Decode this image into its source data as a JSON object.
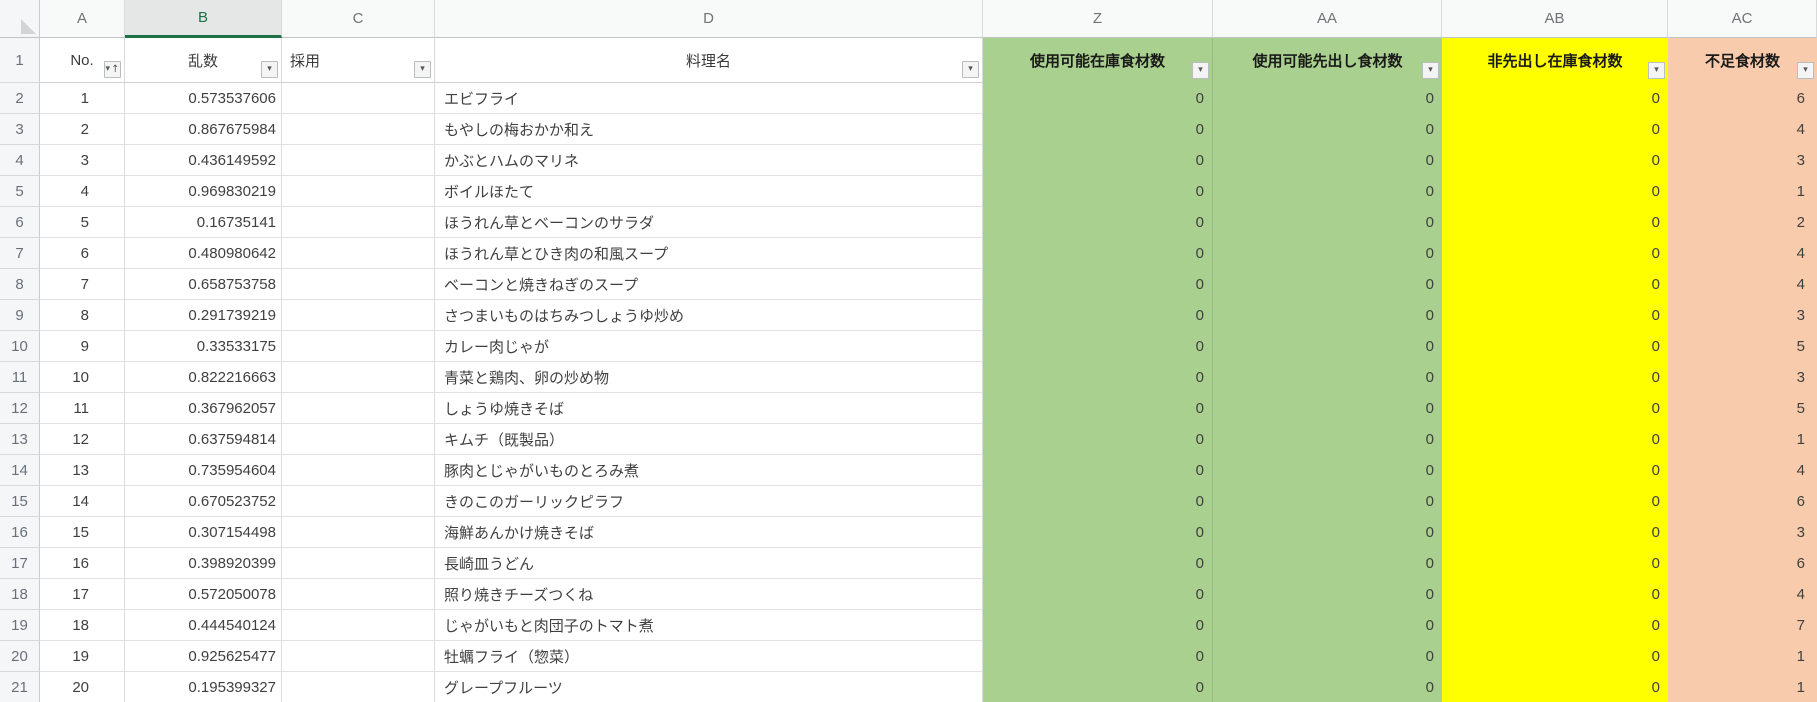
{
  "colors": {
    "green_fill": "#A9D08E",
    "yellow_fill": "#FFFF00",
    "orange_fill": "#F8CBAD",
    "selected_column_accent": "#1E7145"
  },
  "icons": {
    "filter": "▾",
    "sort_asc": "↑",
    "select_all": "corner-triangle"
  },
  "header_row_number": "1",
  "columns": [
    {
      "letter": "A",
      "label": "No.",
      "fill": "none",
      "filter": "sort-ascending",
      "selected": false
    },
    {
      "letter": "B",
      "label": "乱数",
      "fill": "none",
      "filter": "plain",
      "selected": true
    },
    {
      "letter": "C",
      "label": "採用",
      "fill": "none",
      "filter": "plain",
      "selected": false
    },
    {
      "letter": "D",
      "label": "料理名",
      "fill": "none",
      "filter": "plain",
      "selected": false
    },
    {
      "letter": "Z",
      "label": "使用可能在庫食材数",
      "fill": "green",
      "filter": "plain",
      "selected": false
    },
    {
      "letter": "AA",
      "label": "使用可能先出し食材数",
      "fill": "green",
      "filter": "plain",
      "selected": false
    },
    {
      "letter": "AB",
      "label": "非先出し在庫食材数",
      "fill": "yellow",
      "filter": "plain",
      "selected": false
    },
    {
      "letter": "AC",
      "label": "不足食材数",
      "fill": "orange",
      "filter": "plain",
      "selected": false
    }
  ],
  "rows": [
    {
      "row": 2,
      "no": 1,
      "random": "0.573537606",
      "adopt": "",
      "dish": "エビフライ",
      "z": 0,
      "aa": 0,
      "ab": 0,
      "ac": 6
    },
    {
      "row": 3,
      "no": 2,
      "random": "0.867675984",
      "adopt": "",
      "dish": "もやしの梅おかか和え",
      "z": 0,
      "aa": 0,
      "ab": 0,
      "ac": 4
    },
    {
      "row": 4,
      "no": 3,
      "random": "0.436149592",
      "adopt": "",
      "dish": "かぶとハムのマリネ",
      "z": 0,
      "aa": 0,
      "ab": 0,
      "ac": 3
    },
    {
      "row": 5,
      "no": 4,
      "random": "0.969830219",
      "adopt": "",
      "dish": "ボイルほたて",
      "z": 0,
      "aa": 0,
      "ab": 0,
      "ac": 1
    },
    {
      "row": 6,
      "no": 5,
      "random": "0.16735141",
      "adopt": "",
      "dish": "ほうれん草とベーコンのサラダ",
      "z": 0,
      "aa": 0,
      "ab": 0,
      "ac": 2
    },
    {
      "row": 7,
      "no": 6,
      "random": "0.480980642",
      "adopt": "",
      "dish": "ほうれん草とひき肉の和風スープ",
      "z": 0,
      "aa": 0,
      "ab": 0,
      "ac": 4
    },
    {
      "row": 8,
      "no": 7,
      "random": "0.658753758",
      "adopt": "",
      "dish": "ベーコンと焼きねぎのスープ",
      "z": 0,
      "aa": 0,
      "ab": 0,
      "ac": 4
    },
    {
      "row": 9,
      "no": 8,
      "random": "0.291739219",
      "adopt": "",
      "dish": "さつまいものはちみつしょうゆ炒め",
      "z": 0,
      "aa": 0,
      "ab": 0,
      "ac": 3
    },
    {
      "row": 10,
      "no": 9,
      "random": "0.33533175",
      "adopt": "",
      "dish": "カレー肉じゃが",
      "z": 0,
      "aa": 0,
      "ab": 0,
      "ac": 5
    },
    {
      "row": 11,
      "no": 10,
      "random": "0.822216663",
      "adopt": "",
      "dish": "青菜と鶏肉、卵の炒め物",
      "z": 0,
      "aa": 0,
      "ab": 0,
      "ac": 3
    },
    {
      "row": 12,
      "no": 11,
      "random": "0.367962057",
      "adopt": "",
      "dish": "しょうゆ焼きそば",
      "z": 0,
      "aa": 0,
      "ab": 0,
      "ac": 5
    },
    {
      "row": 13,
      "no": 12,
      "random": "0.637594814",
      "adopt": "",
      "dish": "キムチ（既製品）",
      "z": 0,
      "aa": 0,
      "ab": 0,
      "ac": 1
    },
    {
      "row": 14,
      "no": 13,
      "random": "0.735954604",
      "adopt": "",
      "dish": "豚肉とじゃがいものとろみ煮",
      "z": 0,
      "aa": 0,
      "ab": 0,
      "ac": 4
    },
    {
      "row": 15,
      "no": 14,
      "random": "0.670523752",
      "adopt": "",
      "dish": "きのこのガーリックピラフ",
      "z": 0,
      "aa": 0,
      "ab": 0,
      "ac": 6
    },
    {
      "row": 16,
      "no": 15,
      "random": "0.307154498",
      "adopt": "",
      "dish": "海鮮あんかけ焼きそば",
      "z": 0,
      "aa": 0,
      "ab": 0,
      "ac": 3
    },
    {
      "row": 17,
      "no": 16,
      "random": "0.398920399",
      "adopt": "",
      "dish": "長崎皿うどん",
      "z": 0,
      "aa": 0,
      "ab": 0,
      "ac": 6
    },
    {
      "row": 18,
      "no": 17,
      "random": "0.572050078",
      "adopt": "",
      "dish": "照り焼きチーズつくね",
      "z": 0,
      "aa": 0,
      "ab": 0,
      "ac": 4
    },
    {
      "row": 19,
      "no": 18,
      "random": "0.444540124",
      "adopt": "",
      "dish": "じゃがいもと肉団子のトマト煮",
      "z": 0,
      "aa": 0,
      "ab": 0,
      "ac": 7
    },
    {
      "row": 20,
      "no": 19,
      "random": "0.925625477",
      "adopt": "",
      "dish": "牡蠣フライ（惣菜）",
      "z": 0,
      "aa": 0,
      "ab": 0,
      "ac": 1
    },
    {
      "row": 21,
      "no": 20,
      "random": "0.195399327",
      "adopt": "",
      "dish": "グレープフルーツ",
      "z": 0,
      "aa": 0,
      "ab": 0,
      "ac": 1
    }
  ]
}
